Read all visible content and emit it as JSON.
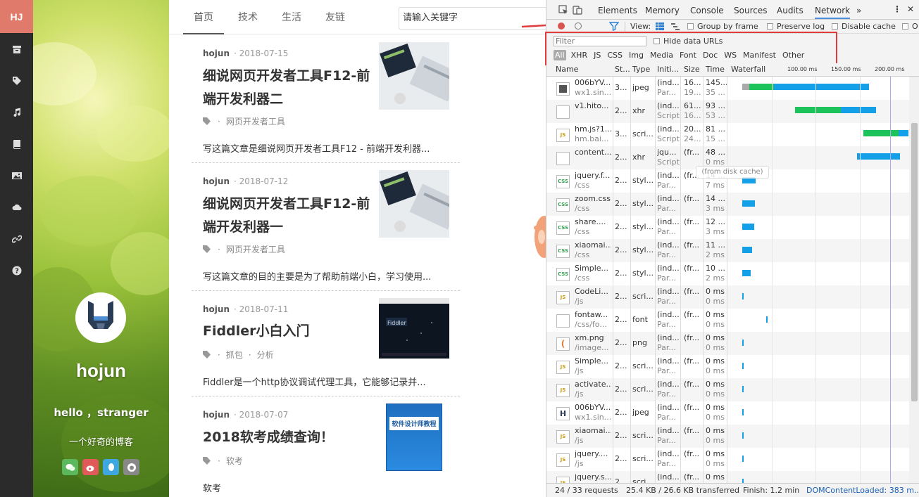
{
  "rail": {
    "logo": "HJ",
    "icons": [
      "archive-icon",
      "tag-icon",
      "music-icon",
      "book-icon",
      "image-icon",
      "cloud-icon",
      "link-icon",
      "help-icon"
    ]
  },
  "profile": {
    "name": "hojun",
    "greeting": "hello ，stranger",
    "motto": "一个好奇的博客",
    "social": [
      {
        "icon": "wechat-icon",
        "color": "#5cb85c"
      },
      {
        "icon": "weibo-icon",
        "color": "#e05a5a"
      },
      {
        "icon": "qq-icon",
        "color": "#3fa7e0"
      },
      {
        "icon": "github-icon",
        "color": "#888888"
      }
    ]
  },
  "nav": {
    "tabs": [
      "首页",
      "技术",
      "生活",
      "友链"
    ],
    "search_placeholder": "请输入关键字"
  },
  "posts": [
    {
      "author": "hojun",
      "date": "2018-07-15",
      "title": "细说网页开发者工具F12-前端开发利器二",
      "tags": [
        "网页开发者工具"
      ],
      "excerpt": "写这篇文章是细说网页开发者工具F12 - 前端开发利器..."
    },
    {
      "author": "hojun",
      "date": "2018-07-12",
      "title": "细说网页开发者工具F12-前端开发利器一",
      "tags": [
        "网页开发者工具"
      ],
      "excerpt": "写这篇文章的目的主要是为了帮助前端小白，学习使用..."
    },
    {
      "author": "hojun",
      "date": "2018-07-11",
      "title": "Fiddler小白入门",
      "tags": [
        "抓包",
        "分析"
      ],
      "excerpt": "Fiddler是一个http协议调试代理工具，它能够记录并..."
    },
    {
      "author": "hojun",
      "date": "2018-07-07",
      "title": "2018软考成绩查询！",
      "tags": [
        "软考"
      ],
      "excerpt": "软考",
      "book_title": "软件设计师教程"
    }
  ],
  "devtools": {
    "tabs": [
      "Elements",
      "Memory",
      "Console",
      "Sources",
      "Audits",
      "Network"
    ],
    "active_tab": "Network",
    "more": "»",
    "toolbar": {
      "view_label": "View:",
      "group_by_frame": "Group by frame",
      "preserve_log": "Preserve log",
      "disable_cache": "Disable cache",
      "offline_short": "O"
    },
    "filter_placeholder": "Filter",
    "hide_data_urls": "Hide data URLs",
    "types": [
      "All",
      "XHR",
      "JS",
      "CSS",
      "Img",
      "Media",
      "Font",
      "Doc",
      "WS",
      "Manifest",
      "Other"
    ],
    "active_type": "All",
    "columns": [
      "Name",
      "St...",
      "Type",
      "Initi...",
      "Size",
      "Time",
      "Waterfall"
    ],
    "ticks": [
      "100.00 ms",
      "150.00 ms",
      "200.00 ms"
    ],
    "tooltip": "(from disk cache)",
    "rows": [
      {
        "name": "006bYV...",
        "sub": "wx1.sin...",
        "status": "3...",
        "type": "jpeg",
        "init": "(ind...",
        "init2": "Par...",
        "size": "16...",
        "size2": "19...",
        "time": "145...",
        "time2": "35 ...",
        "icon": "img"
      },
      {
        "name": "v1.hito...",
        "sub": "",
        "status": "2...",
        "type": "xhr",
        "init": "(ind...",
        "init2": "Script",
        "size": "61...",
        "size2": "16...",
        "time": "93 ...",
        "time2": "53 ...",
        "icon": "blank"
      },
      {
        "name": "hm.js?1...",
        "sub": "hm.bai...",
        "status": "3...",
        "type": "scri...",
        "init": "(ind...",
        "init2": "Script",
        "size": "20...",
        "size2": "24...",
        "time": "81 ...",
        "time2": "15 ...",
        "icon": "js"
      },
      {
        "name": "content...",
        "sub": "",
        "status": "2...",
        "type": "xhr",
        "init": "jqu...",
        "init2": "Script",
        "size": "(fr...",
        "size2": "",
        "time": "48 ...",
        "time2": "0 ms",
        "icon": "blank"
      },
      {
        "name": "jquery.f...",
        "sub": "/css",
        "status": "2...",
        "type": "styl...",
        "init": "(ind...",
        "init2": "Par...",
        "size": "(fr...",
        "size2": "",
        "time": "14 ...",
        "time2": "7 ms",
        "icon": "css"
      },
      {
        "name": "zoom.css",
        "sub": "/css",
        "status": "2...",
        "type": "styl...",
        "init": "(ind...",
        "init2": "Par...",
        "size": "(fr...",
        "size2": "",
        "time": "14 ...",
        "time2": "3 ms",
        "icon": "css"
      },
      {
        "name": "share....",
        "sub": "/css",
        "status": "2...",
        "type": "styl...",
        "init": "(ind...",
        "init2": "Par...",
        "size": "(fr...",
        "size2": "",
        "time": "12 ...",
        "time2": "3 ms",
        "icon": "css"
      },
      {
        "name": "xiaomai...",
        "sub": "/css",
        "status": "2...",
        "type": "styl...",
        "init": "(ind...",
        "init2": "Par...",
        "size": "(fr...",
        "size2": "",
        "time": "11 ...",
        "time2": "2 ms",
        "icon": "css"
      },
      {
        "name": "Simple...",
        "sub": "/css",
        "status": "2...",
        "type": "styl...",
        "init": "(ind...",
        "init2": "Par...",
        "size": "(fr...",
        "size2": "",
        "time": "10 ...",
        "time2": "2 ms",
        "icon": "css"
      },
      {
        "name": "CodeLi...",
        "sub": "/js",
        "status": "2...",
        "type": "scri...",
        "init": "(ind...",
        "init2": "Par...",
        "size": "(fr...",
        "size2": "",
        "time": "0 ms",
        "time2": "0 ms",
        "icon": "js"
      },
      {
        "name": "fontaw...",
        "sub": "/css/fo...",
        "status": "2...",
        "type": "font",
        "init": "(ind...",
        "init2": "Par...",
        "size": "(fr...",
        "size2": "",
        "time": "0 ms",
        "time2": "0 ms",
        "icon": "blank"
      },
      {
        "name": "xm.png",
        "sub": "/image...",
        "status": "2...",
        "type": "png",
        "init": "(ind...",
        "init2": "Par...",
        "size": "(fr...",
        "size2": "",
        "time": "0 ms",
        "time2": "0 ms",
        "icon": "png"
      },
      {
        "name": "Simple...",
        "sub": "/js",
        "status": "2...",
        "type": "scri...",
        "init": "(ind...",
        "init2": "Par...",
        "size": "(fr...",
        "size2": "",
        "time": "0 ms",
        "time2": "0 ms",
        "icon": "js"
      },
      {
        "name": "activate...",
        "sub": "/js",
        "status": "2...",
        "type": "scri...",
        "init": "(ind...",
        "init2": "Par...",
        "size": "(fr...",
        "size2": "",
        "time": "0 ms",
        "time2": "0 ms",
        "icon": "js"
      },
      {
        "name": "006bYV...",
        "sub": "wx1.sin...",
        "status": "2...",
        "type": "jpeg",
        "init": "(ind...",
        "init2": "Par...",
        "size": "(fr...",
        "size2": "",
        "time": "0 ms",
        "time2": "0 ms",
        "icon": "logo"
      },
      {
        "name": "xiaomai...",
        "sub": "/js",
        "status": "2...",
        "type": "scri...",
        "init": "(ind...",
        "init2": "Par...",
        "size": "(fr...",
        "size2": "",
        "time": "0 ms",
        "time2": "0 ms",
        "icon": "js"
      },
      {
        "name": "jquery....",
        "sub": "/js",
        "status": "2...",
        "type": "scri...",
        "init": "(ind...",
        "init2": "Par...",
        "size": "(fr...",
        "size2": "",
        "time": "0 ms",
        "time2": "0 ms",
        "icon": "js"
      },
      {
        "name": "jquery.s...",
        "sub": "",
        "status": "2...",
        "type": "scri...",
        "init": "(ind...",
        "init2": "",
        "size": "(fr...",
        "size2": "",
        "time": "0 ms",
        "time2": "",
        "icon": "js"
      }
    ],
    "status_bar": {
      "requests": "24 / 33 requests",
      "transferred": "25.4 KB / 26.6 KB transferred",
      "finish": "Finish: 1.2 min",
      "dcl": "DOMContentLoaded: 383 m..."
    }
  }
}
